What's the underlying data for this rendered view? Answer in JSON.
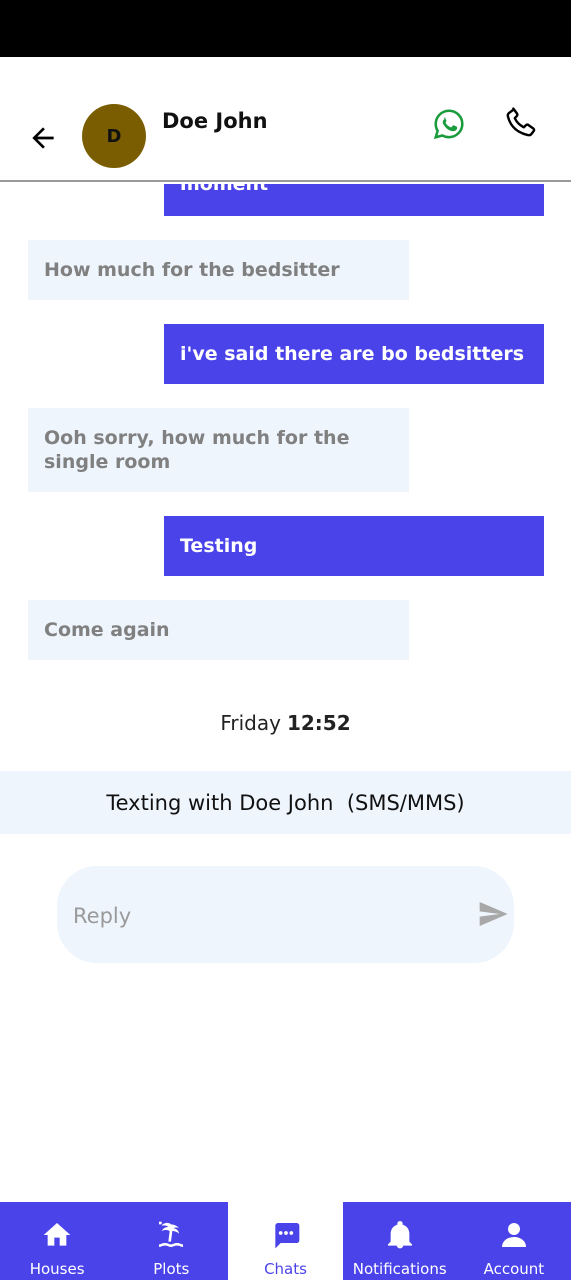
{
  "header": {
    "avatar_initial": "D",
    "contact_name": "Doe John"
  },
  "messages": [
    {
      "direction": "out",
      "text": "moment"
    },
    {
      "direction": "in",
      "text": "How much for the bedsitter"
    },
    {
      "direction": "out",
      "text": "i've said there are bo bedsitters"
    },
    {
      "direction": "in",
      "text": "Ooh sorry, how much for the single room"
    },
    {
      "direction": "out",
      "text": "Testing"
    },
    {
      "direction": "in",
      "text": "Come again"
    }
  ],
  "timestamp": {
    "day": "Friday",
    "time": "12:52"
  },
  "banner": {
    "text": "Texting with Doe John  (SMS/MMS)"
  },
  "reply": {
    "placeholder": "Reply",
    "value": ""
  },
  "nav": {
    "items": [
      {
        "label": "Houses",
        "icon": "home-icon",
        "active": false
      },
      {
        "label": "Plots",
        "icon": "island-icon",
        "active": false
      },
      {
        "label": "Chats",
        "icon": "chat-icon",
        "active": true
      },
      {
        "label": "Notifications",
        "icon": "bell-icon",
        "active": false
      },
      {
        "label": "Account",
        "icon": "person-icon",
        "active": false
      }
    ]
  },
  "colors": {
    "accent": "#4b43ea",
    "incoming_bubble": "#eef5fd",
    "whatsapp": "#1a9c3c",
    "avatar": "#7a5d00"
  }
}
